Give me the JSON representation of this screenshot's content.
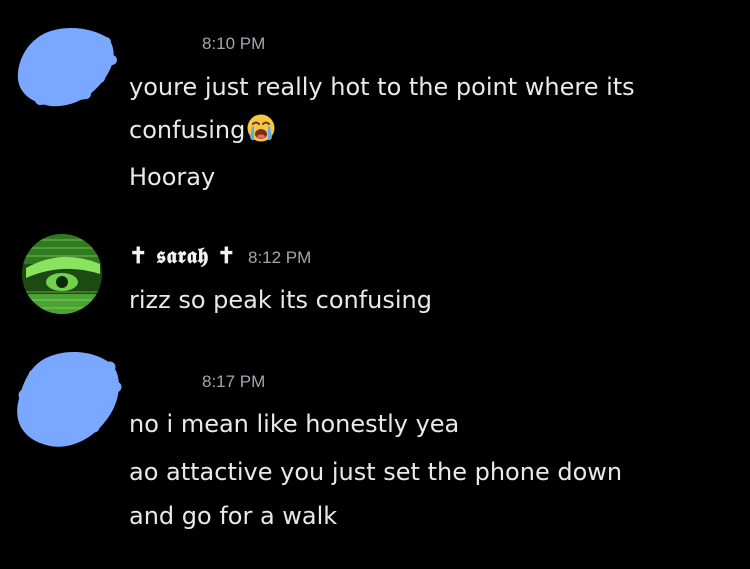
{
  "messages": [
    {
      "time": "8:10 PM",
      "lines": [
        "youre just really hot to the point where its",
        "confusing",
        "Hooray"
      ],
      "emoji": "loudly-crying-face-icon"
    },
    {
      "username": "✝ 𝖘𝖆𝖗𝖆𝖍 ✝",
      "time": "8:12 PM",
      "lines": [
        "rizz so peak its confusing"
      ]
    },
    {
      "time": "8:17 PM",
      "lines": [
        "no i mean like honestly yea",
        "ao attactive you just set the phone down",
        "and go for a walk"
      ]
    }
  ],
  "colors": {
    "background": "#000000",
    "redaction_scribble": "#7aa7ff",
    "avatar_green": "#6fd24a",
    "timestamp": "#a3a6aa"
  }
}
